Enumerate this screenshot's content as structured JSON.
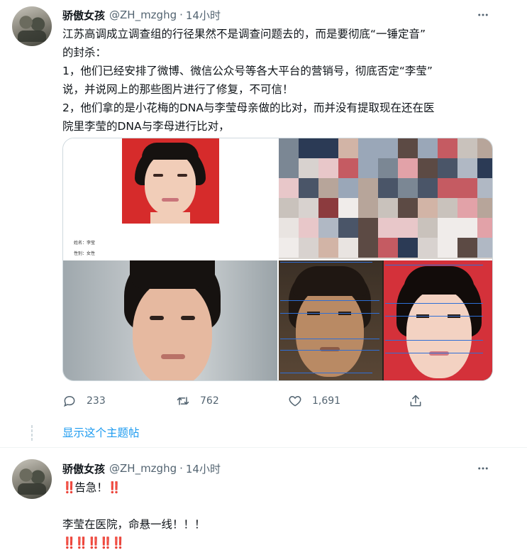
{
  "tweet1": {
    "display_name": "骄傲女孩",
    "handle": "@ZH_mzghg",
    "separator": "·",
    "time": "14小时",
    "lines": [
      "江苏高调成立调查组的行径果然不是调查问题去的，而是要彻底“一锤定音”",
      "的封杀：",
      "1，他们已经安排了微博、微信公众号等各大平台的营销号，彻底否定“李莹”",
      "说，并说网上的那些图片进行了修复，不可信！",
      "2，他们拿的是小花梅的DNA与李莹母亲做的比对，而并没有提取现在还在医",
      "院里李莹的DNA与李母进行比对，"
    ],
    "id_card": {
      "name_label": "姓名：李莹",
      "gender_label": "性别：女性"
    },
    "actions": {
      "replies": "233",
      "retweets": "762",
      "likes": "1,691"
    },
    "show_thread": "显示这个主题帖"
  },
  "tweet2": {
    "display_name": "骄傲女孩",
    "handle": "@ZH_mzghg",
    "separator": "·",
    "time": "14小时",
    "line1_bangs_left": "‼️",
    "line1_text": "告急！",
    "line1_bangs_right": "‼️",
    "line2": "李莹在医院，命悬一线！！！",
    "line3_bangs": "‼️‼️‼️‼️‼️"
  },
  "colors": {
    "accent": "#1d9bf0",
    "text": "#0f1419",
    "muted": "#536471",
    "id_photo_background": "#d62b2b",
    "guide_lines": "#2f6fd6"
  },
  "icons": [
    "more-horizontal-icon",
    "reply-icon",
    "retweet-icon",
    "like-icon",
    "share-icon"
  ]
}
